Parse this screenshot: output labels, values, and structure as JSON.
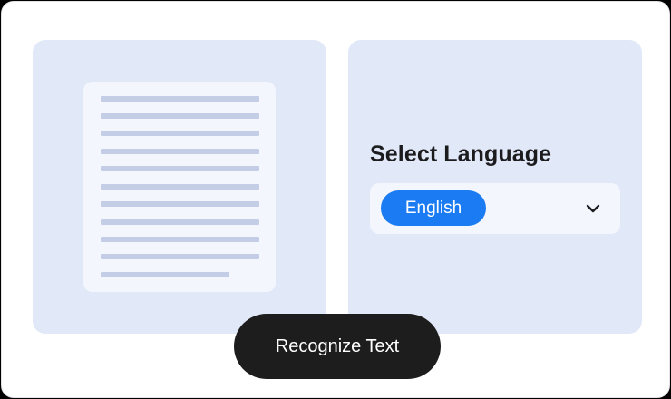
{
  "language_panel": {
    "title": "Select Language",
    "selected_language": "English",
    "dropdown_icon": "chevron-down-icon"
  },
  "document_preview": {
    "icon": "document-icon",
    "text_line_count": 11
  },
  "actions": {
    "recognize_label": "Recognize Text"
  },
  "colors": {
    "panel_background": "#e1e8f8",
    "card_background": "#f3f6fd",
    "text_line": "#c3cde6",
    "accent": "#1a7bf2",
    "button_background": "#1d1d1d",
    "title_text": "#1c1c1e"
  }
}
